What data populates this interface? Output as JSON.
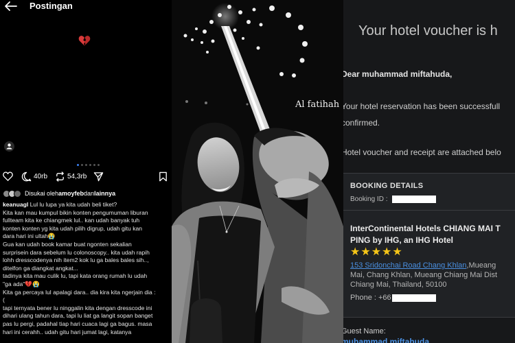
{
  "instagram": {
    "header_title": "Postingan",
    "heart_emoji": "💔",
    "comments_count": "40rb",
    "reposts_count": "54,3rb",
    "liked_by_prefix": "Disukai oleh ",
    "liked_by_user": "amoyfeb",
    "liked_by_and": " dan ",
    "liked_by_rest": "lainnya",
    "caption_username": "keanuagl",
    "caption_first": " Lul lu lupa ya kita udah beli tiket?",
    "caption_lines": [
      "Kita kan mau kumpul bikin konten pengumuman liburan",
      "fullteam kita ke chiangmek lul.. kan udah banyak tuh",
      "konten konten yg kita udah pilih digrup, udah gitu kan",
      "dara hari ini ultah😭",
      "Gua kan udah book kamar buat ngonten sekalian",
      "surprisein dara sebelum lu colonoscopy.. kita udah rapih",
      "lohh dresscodenya nih item2 kok lu ga bales bales sih..,",
      "ditelfon ga diangkat angkat...",
      "tadinya kita mau culik lu, tapi kata orang rumah lu udah",
      "\"ga ada\"💔😭",
      "Kita ga percaya lul apalagi dara.. dia kira kita ngerjain dia :",
      "(",
      "tapi ternyata bener lu ninggalin kita dengan dresscode ini",
      "dihari ulang tahun dara, tapi lu liat ga langit sopan banget",
      "pas lu pergi, padahal tiap hari cuaca lagi ga bagus. masa",
      "hari ini cerahh.. udah gitu hari jumat lagi, katanya"
    ]
  },
  "photo": {
    "overlay_text": "Al fatihah"
  },
  "email": {
    "title": "Your hotel voucher is h",
    "greeting": "Dear muhammad miftahuda,",
    "body_line1": "Your hotel reservation has been successfull",
    "body_line2": "confirmed.",
    "body_line3": "Hotel voucher and receipt are attached belo",
    "booking_details_title": "BOOKING DETAILS",
    "booking_id_label": "Booking ID :",
    "hotel_name_line1": "InterContinental Hotels CHIANG MAI T",
    "hotel_name_line2": "PING by IHG, an IHG Hotel",
    "stars": "★★★★★",
    "address_link": "153 Sridonchai Road Chang Khlan",
    "address_rest1": ",Mueang",
    "address_line2": "Mai, Chang Khlan, Mueang Chiang Mai Dist",
    "address_line3": "Chiang Mai, Thailand, 50100",
    "phone_label": "Phone : +66",
    "guest_label": "Guest Name:",
    "guest_name": "muhammad miftahuda"
  },
  "colors": {
    "link_blue": "#4a90e2",
    "star_gold": "#f5c518",
    "carousel_active": "#3b82f6",
    "email_bg": "#17181a"
  }
}
